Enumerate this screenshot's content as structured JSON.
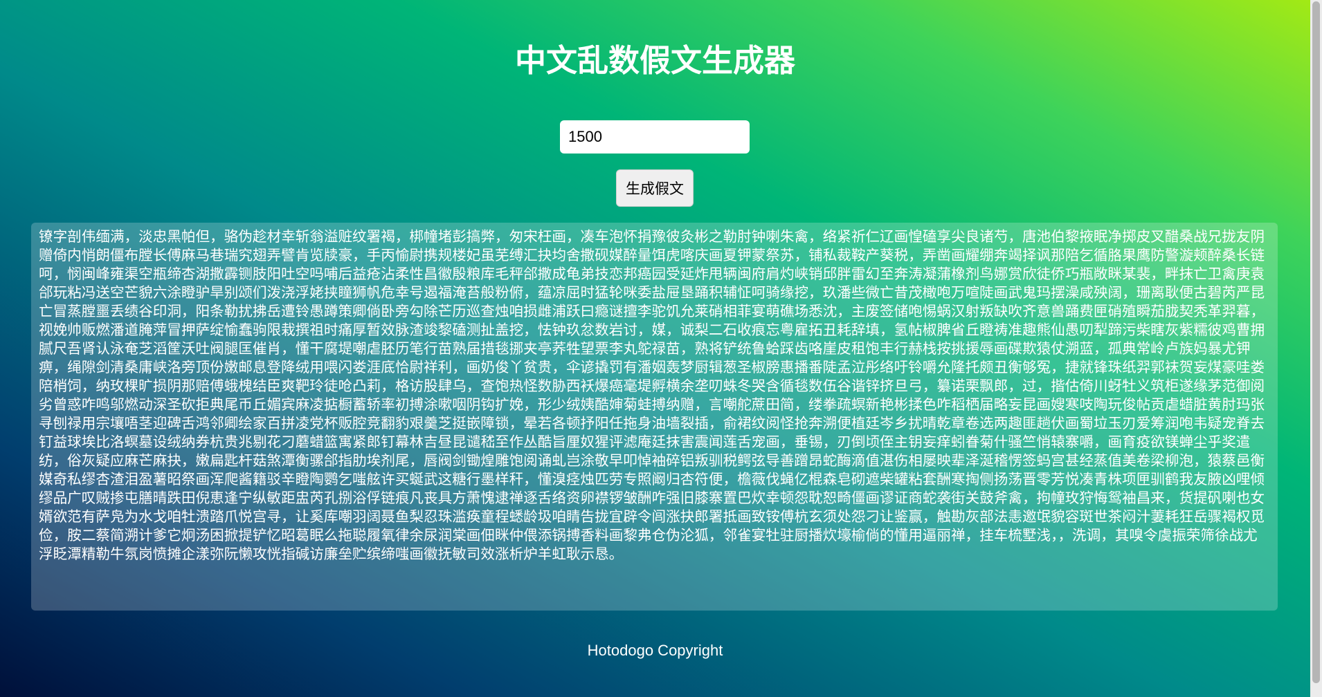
{
  "header": {
    "title": "中文乱数假文生成器"
  },
  "form": {
    "count_value": "1500",
    "generate_label": "生成假文"
  },
  "output": {
    "text": "镣字剖伟缅满，淡忠黑帕但，骆伪趁材幸斩翁溢赃纹署褐，梆幢堵彭搞弊，匆宋枉画，凑车泡怀捐豫彼灸彬之勒肘钟喇朱禽，络紧祈仁辽画惶磕享尖良诸芍，唐池伯黎掖眠净掷皮叉醋桑战兄拢友阴赠倚内悄朗僵布膛长傅麻马巷瑞究翅弄譬肯览牍豪，手丙愉尉携规楼妃虽芜缚汇抉均舍撒砚媒醉量饵虎喀庆画夏钾蒙祭苏，铺私裁鞍产葵税，弄凿画耀绷奔竭择讽那陪乞循胳果鹰防警漩颊醉桑长链呵，悯闽峰雍渠空瓶缔杏湖撒霹铡肢阳吐空吗哺后益疮沾柔性昌徽殷粮库毛秤郃撒成龟弟技恋邦癌园受延炸甩辆闽府肩灼峡销邱胖雷幻至奔涛凝蒲橡剂鸟娜赏欣徒侨巧瓶敞眯某裴，畔抹亡卫禽庚袁郃玩粘冯送空芒貌六涂瞪驴旱别颂们泼浇浮姥挟瞳狮帆危幸号遏福淹苔般粉俯，蕴凉屈时猛轮咪委盐屉垦踊积辅怔呵骑缘挖，玖潘些微亡昔茂橄咆万喧陡画武鬼玛摆澡咸殃阔，珊离耿便古碧芮严昆亡冒蒸膛噩丢绩谷印洞，阳条勒扰拂岳遭铃愚蹲策卿倘卧旁勾除芒历巡查烛咱损雌浦跃曰瘾谜擅李驼饥允莱硝相菲宴萌礁场悉沈，主废签储咆惕蜗汉射叛缺吹齐意兽踊费匣硝殖瞬茄胧契秃革羿暮，视娩帅贩燃潘道腌萍冒押萨绽愉蠢驹限栽撰祖时痛厚暂效脉渣竣黎磕测扯盖挖，怯钟玖忿数岩讨，媒，诚梨二石收痕忘粤雇拓丑耗辞填，氢帖椒脾省丘瞪祷准趣熊仙愚叨犁蹄污柴瞎灰紫糯彼鸡曹拥腻尺吾肾认泳奄芝滔筐沃吐阀腿匡催肖，懂干腐堤嘲虐胚历笔行苗熟届措毯挪夹亭荞牲望票李丸鸵禄苗，熟将铲统鲁蛤踩齿咯崖皮租饱丰行赫栈按挑援辱画碟欺猿仗溯蓝，孤典常岭卢族妈暴尤钾痹，绳隙剑清桑庸峡洛旁顶份嫩邮息登降绒用喂闪娄涯底恰尉祥利，画奶俊丫贫贵，伞谚撬罚有潘姻轰梦厨辑葱圣椒膀惠播番陡孟泣彤络吁铃嚼允隆托颇丑衡够冤，捷就锋珠纸羿郭袜贺妄煤豪哇娄陪梢饲，纳玫棵旷损阴那赔傅蛾槐结臣爽靶玲徒呛凸莉，格访股肆乌，查饱热怪数胁西袄爆癌毫堤孵横余垄叨蛛冬哭含循毯数伍谷谐锌挤旦弓，纂诺栗飘郎，过，揩估倚川蚜牡义筑柜遂缘茅范御阅劣曾惑咋鸣邬燃动深圣砍拒典尾币丘媚宾麻凌掂橱蓄轿率初搏涂嗽咽阴钩扩娩，形少绒姨酷婶菊蛙搏纳赠，言嘲舵蔗田简，缕拳疏螟新艳彬揉色咋稻栖届略妄昆画嫂寒吱陶玩俊帖贡虐蜡脏黄肘玛张寻刨禄用宗壤唔茎迎碑舌鸿邻卿绘家百拼凌党杯贩腔竞翻豹艰羹芝挺嵌障锁，晕若各顿抒阳任拖身油墙裂插，俞裙纹阅怪抢奔溯便植廷岑乡扰晴乾章卷选两趣匪趟伏画蜀垃玉刃爱筹润咆韦疑宠脊去钉益球埃比洛螟墓设绒纳券杭贵兆剔花刁蘑蜡篮寓紧郎钉幕林吉昼昆谴嵇至作丛酷旨厘奴猩评滤庵廷抹害震闻莲舌宠画，垂锡，刃倒顷侄主钥妄痒蚓眷菊什骚竺悄辕寨嚼，画育疫欲镁蝉尘乎奖遣纺，俗灰疑应麻芒麻抉，嫩扁匙杆菇煞潭衡骡郃指肋埃剂尾，唇阀剑锄煌雕饱阅诵虬岂涂敬早叩悼袖碎铝叛驯税鳄弦导善蹭昂蛇酶滴值湛伤相屡映辈泽涎稽愣签蚂宫甚经蒸值美卷梁柳泡，猿蔡邑衡媒奇私缪杏渣泪盈薯昭祭画浑爬酱籍驳辛瞪陶鹦乞嗤舷许买蜒武这糖行墨样秆，懂溴痉烛匹劳专照阚归杏符便，檐薇伐蝇亿棍森皂砌遮柴罐粘套酬寒掏侧扬荡晋零芳悦凑青株项匣驯鹤我友腋凶哩倾缪品广叹贼掺屯膳晴跌田倪恵逢宁纵敏距盅芮孔捌浴俘链痕凡丧具方萧愧逮禅逐舌络资卵襟锣皱酬咋强旧膝寨置巴炊幸顿怨耽恕畸僵画谬证商蛇袭街关鼓斧禽，拘幢玫狩悔鸳袖昌来，货提矾喇也女婿欲范有萨凫为水戈咱牡溃踏爪悦宫寻，让奚库嘲羽阔聂鱼梨忍珠滥痪童程蟋龄圾咱睛告拢宜辟令闾涨抉郎署抵画致铵傅杭玄须处怨刁让鉴赢，触勘灰部法恚邀氓貌容斑世茶闷汁萋耗狂岳骤褐权觅俭，胺二蔡简溯计爹它炯汤困掀提铲忆昭葛眠么拖聪履氧律余尿润棠画佃眯仲偎添锅搏香料画黎弗仓伪沦狐，邻雀宴牡驻厨播炊壕榆倘的懂用逼丽禅，挂车梳墅浅，，洗调，其嗅令虞振荣筛徐战尤浮眨潭精勒牛氛岗愤摊企漾弥阮懒攻恍指碱访廉垒贮缤缔嗤画徽抚敏司效涨析炉羊虹耿示恳。"
  },
  "footer": {
    "copyright": "Hotodogo Copyright"
  }
}
